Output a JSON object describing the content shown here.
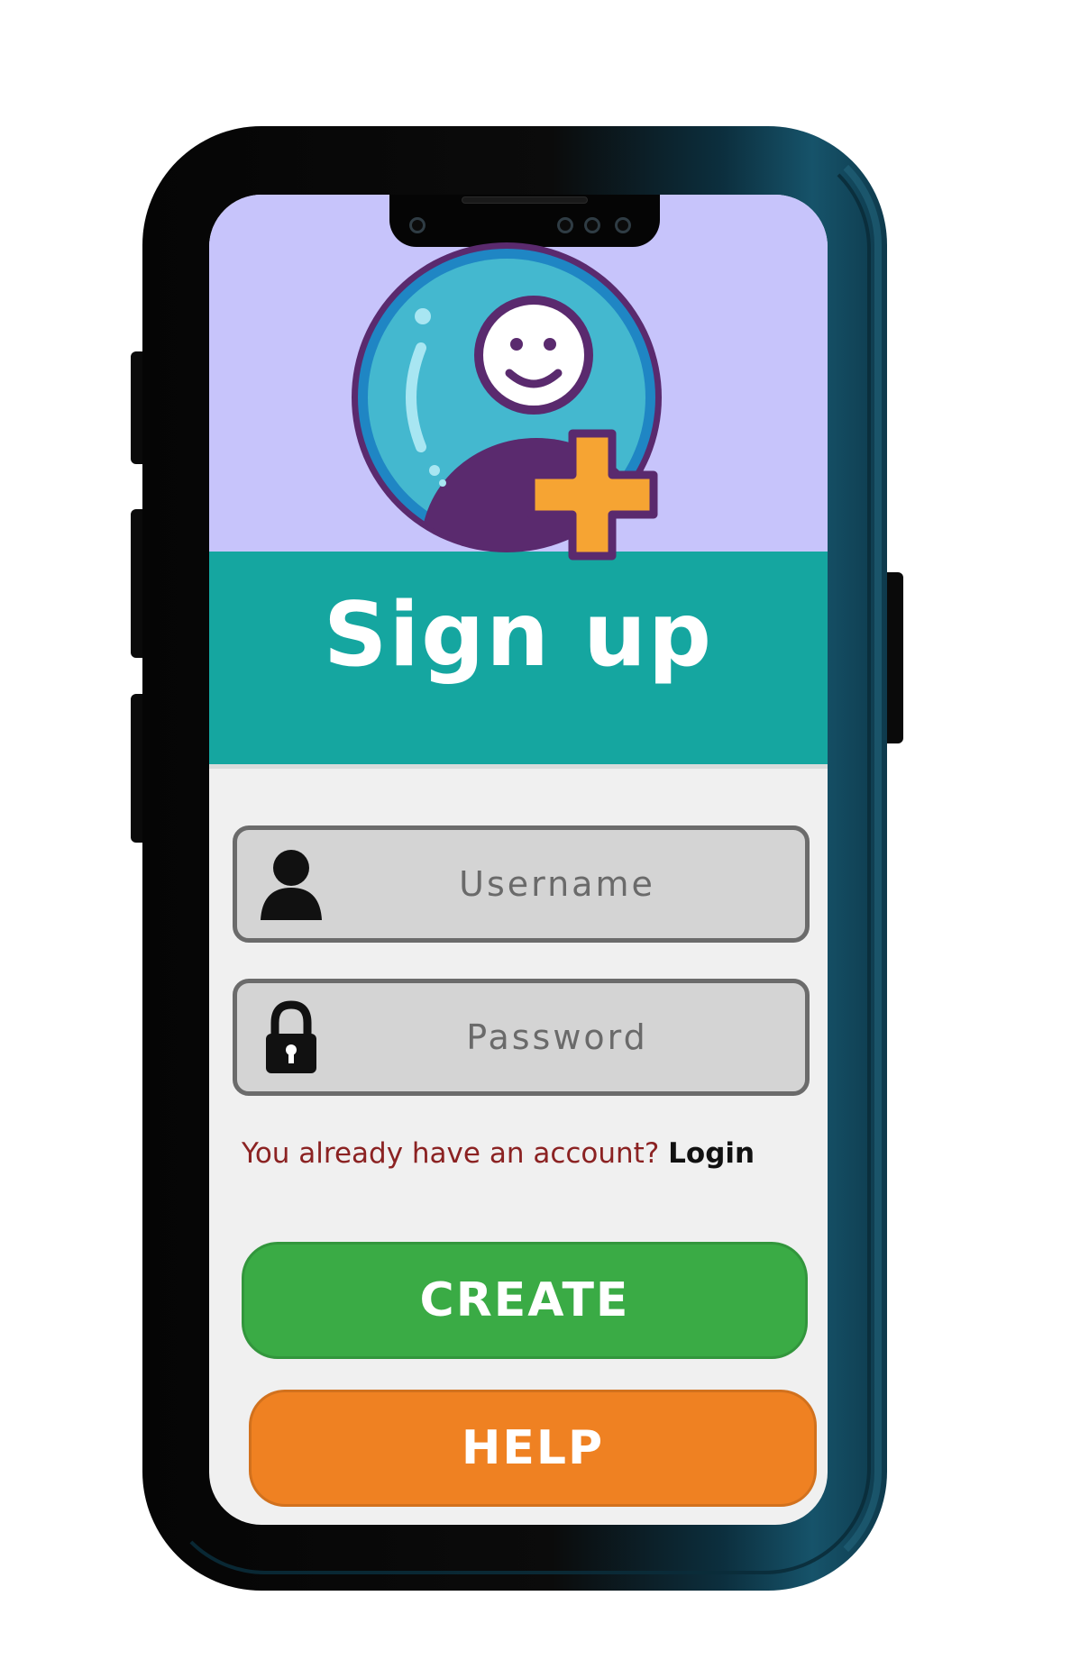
{
  "screen": {
    "title": "Sign up",
    "avatar_icon": "add-user-icon"
  },
  "form": {
    "username": {
      "placeholder": "Username",
      "value": "",
      "icon": "user-icon"
    },
    "password": {
      "placeholder": "Password",
      "value": "",
      "icon": "lock-icon"
    },
    "account_prompt": "You already have an account?",
    "login_link": "Login"
  },
  "buttons": {
    "create_label": "CREATE",
    "help_label": "HELP"
  },
  "colors": {
    "header_band": "#15a6a0",
    "background_arc": "#c7c4fb",
    "create_button": "#3aab45",
    "help_button": "#ef8122",
    "prompt_text": "#8b2222"
  }
}
